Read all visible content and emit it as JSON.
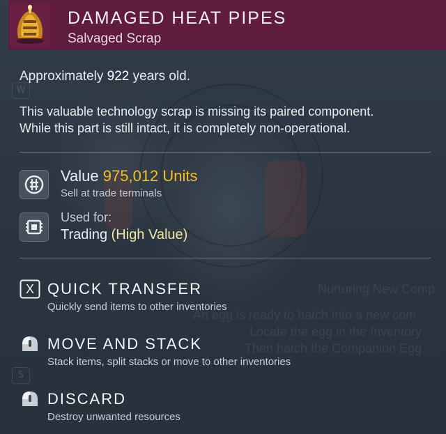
{
  "item": {
    "name": "DAMAGED HEAT PIPES",
    "category": "Salvaged Scrap",
    "icon": "heat-pipe-scrap-icon",
    "age_prefix": "Approximately ",
    "age_value": "922",
    "age_suffix": " years old.",
    "description_line1": "This valuable technology scrap is missing its paired component.",
    "description_line2": "While this part is still intact, it is completely non-operational."
  },
  "stats": {
    "value_label": "Value",
    "value_amount": "975,012 Units",
    "value_note": "Sell at trade terminals",
    "used_for_label": "Used for:",
    "used_for_value": "Trading",
    "used_for_qualifier": "(High Value)"
  },
  "actions": [
    {
      "key_hint": "X",
      "icon": "x-key-icon",
      "title": "QUICK TRANSFER",
      "description": "Quickly send items to other inventories"
    },
    {
      "icon": "mouse-left-icon",
      "title": "MOVE AND STACK",
      "description": "Stack items, split stacks or move to other inventories"
    },
    {
      "icon": "mouse-left-icon",
      "title": "DISCARD",
      "description": "Destroy unwanted resources"
    }
  ],
  "background": {
    "mission_title": "Nurturing New Comp",
    "mission_line1": "An egg is ready to hatch into a new com",
    "mission_line2": "Locate the egg in the Inventory",
    "mission_line3": "Then hatch the Companion Egg",
    "key_w": "W",
    "key_s": "S"
  },
  "colors": {
    "header_bg": "#5f1c3e",
    "value_gold": "#f5be27",
    "qualifier_pale_yellow": "#eee7a4",
    "text_white": "#e7ecf0"
  }
}
